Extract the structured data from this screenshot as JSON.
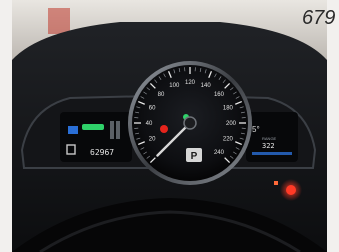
{
  "speedometer": {
    "scale_labels": [
      "20",
      "40",
      "60",
      "80",
      "100",
      "120",
      "140",
      "160",
      "180",
      "200",
      "220",
      "240"
    ],
    "needle_value": 0,
    "gear": "P"
  },
  "left_display": {
    "odometer": "62967"
  },
  "right_display": {
    "temperature": "5°",
    "range_value": "322",
    "label_small": "RANGE"
  },
  "colors": {
    "needle": "#d8d8d8",
    "gear_box": "#d6d6d6",
    "warning_red": "#e6241c",
    "eco_green": "#2fd26a",
    "accent_blue": "#2a6fd6"
  },
  "background_text": "679"
}
